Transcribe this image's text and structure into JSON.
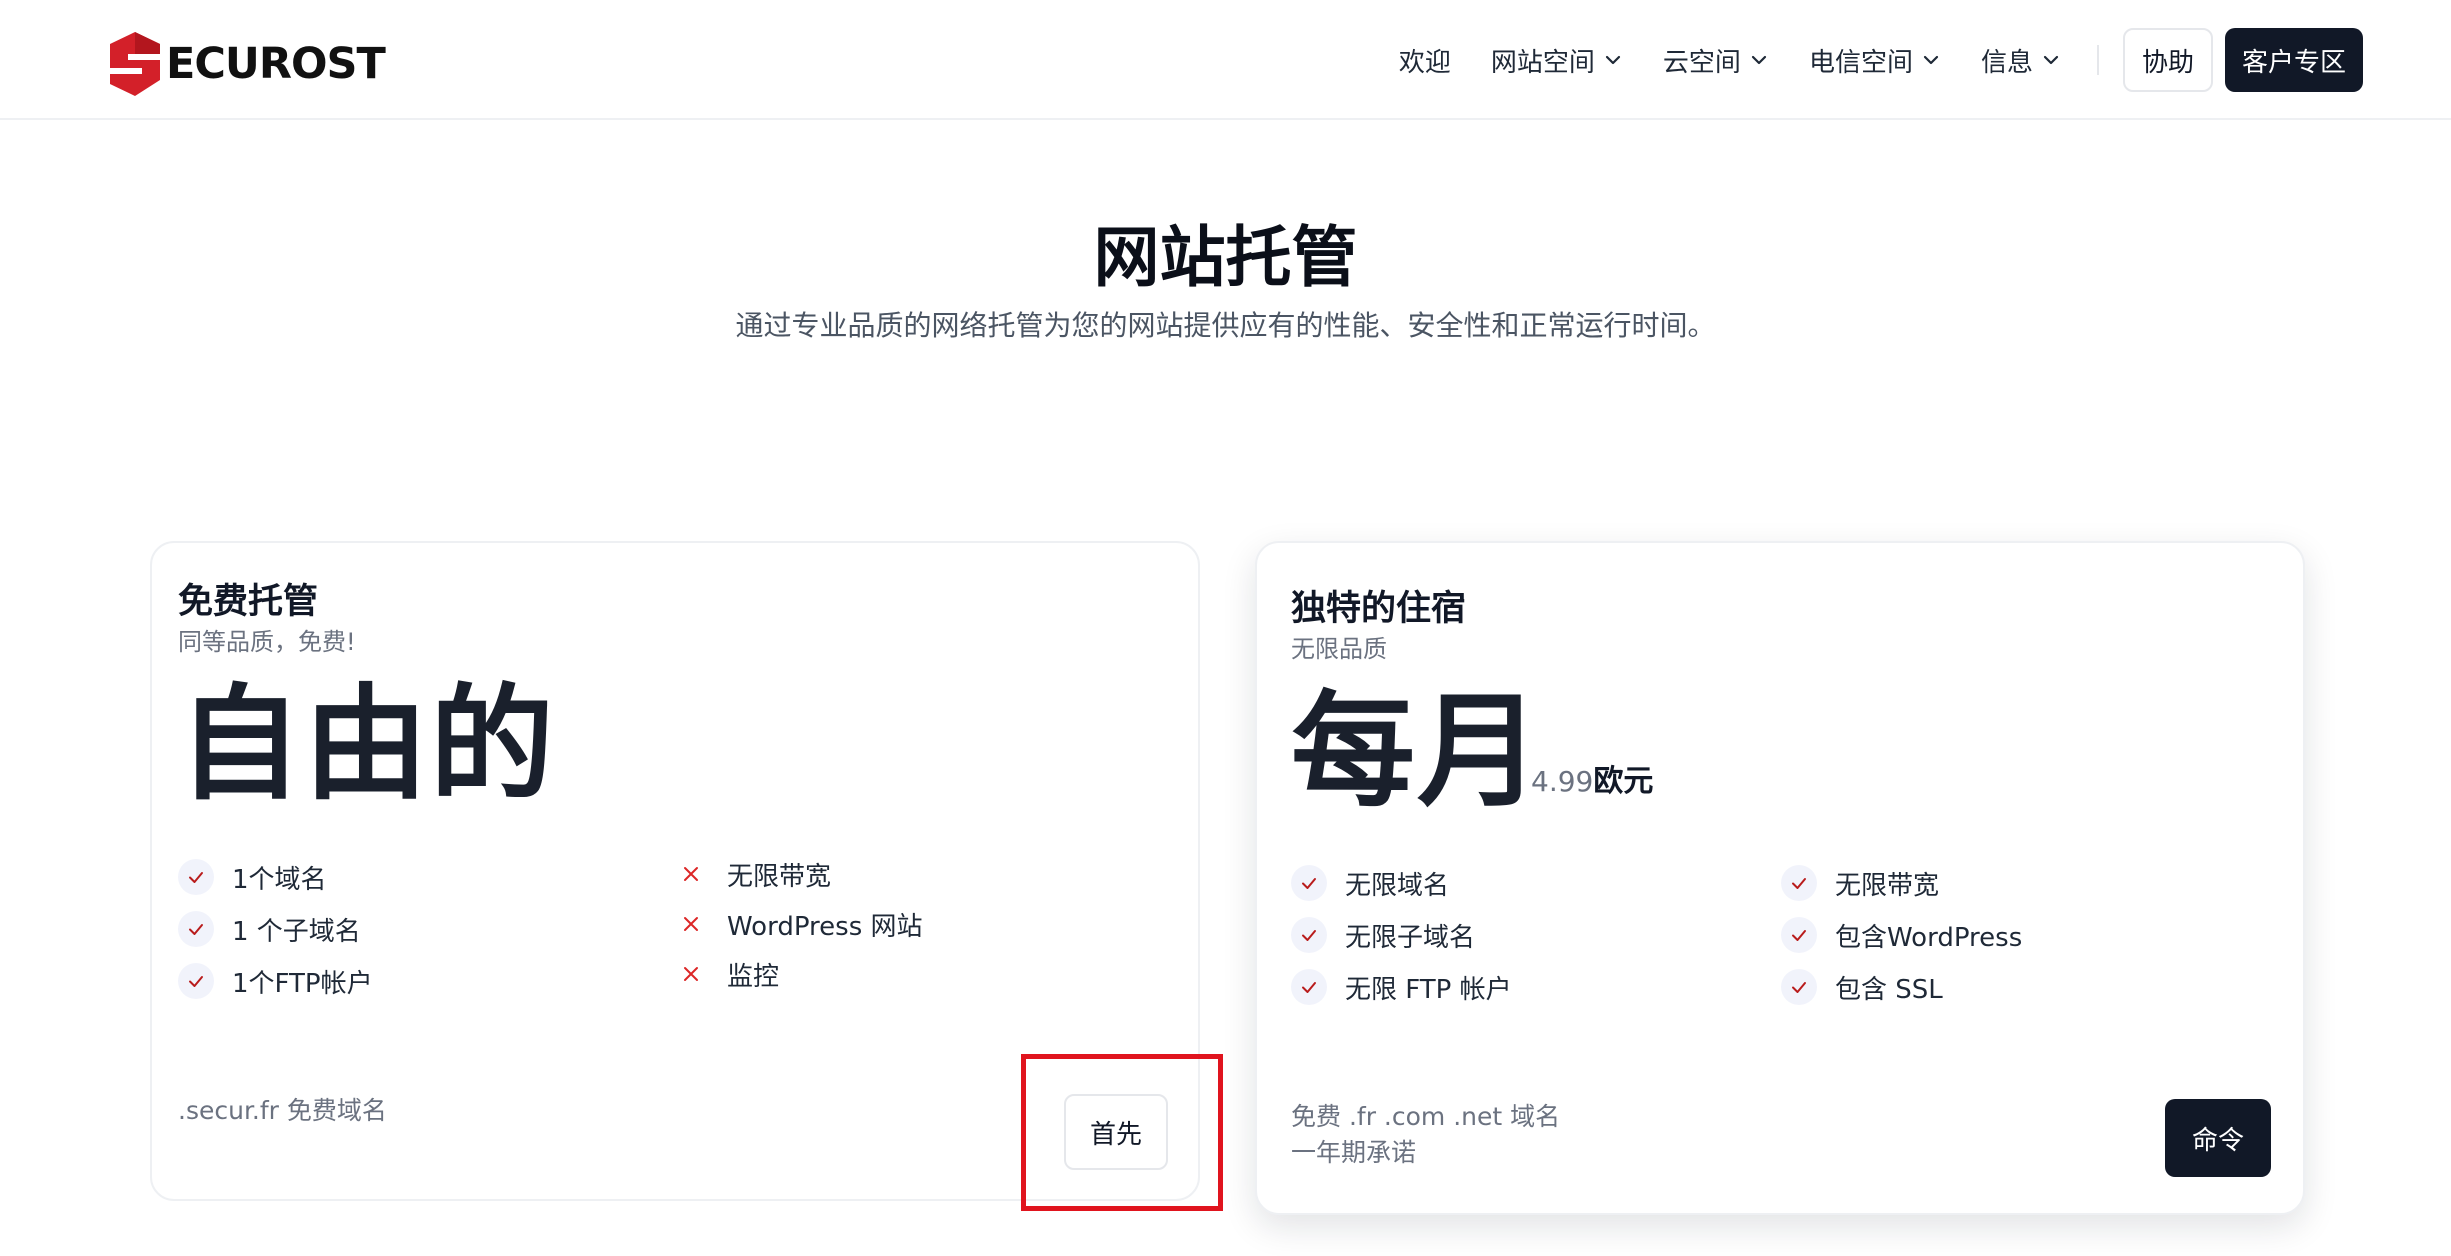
{
  "brand": {
    "logo_text": "ECUROST",
    "logo_color": "#d32029"
  },
  "nav": {
    "items": [
      {
        "label": "欢迎",
        "dropdown": false
      },
      {
        "label": "网站空间",
        "dropdown": true
      },
      {
        "label": "云空间",
        "dropdown": true
      },
      {
        "label": "电信空间",
        "dropdown": true
      },
      {
        "label": "信息",
        "dropdown": true
      }
    ],
    "help_label": "协助",
    "client_label": "客户专区"
  },
  "hero": {
    "title": "网站托管",
    "subtitle": "通过专业品质的网络托管为您的网站提供应有的性能、安全性和正常运行时间。"
  },
  "plans": [
    {
      "title": "免费托管",
      "subtitle": "同等品质，免费!",
      "price_big": "自由的",
      "features_left": [
        {
          "label": "1个域名",
          "included": true
        },
        {
          "label": "1 个子域名",
          "included": true
        },
        {
          "label": "1个FTP帐户",
          "included": true
        }
      ],
      "features_right": [
        {
          "label": "无限带宽",
          "included": false
        },
        {
          "label": "WordPress 网站",
          "included": false
        },
        {
          "label": "监控",
          "included": false
        }
      ],
      "footnote": ".secur.fr 免费域名",
      "button_label": "首先"
    },
    {
      "title": "独特的住宿",
      "subtitle": "无限品质",
      "price_big": "每月",
      "price_amount": "4.99",
      "price_unit": "欧元",
      "features_left": [
        {
          "label": "无限域名",
          "included": true
        },
        {
          "label": "无限子域名",
          "included": true
        },
        {
          "label": "无限 FTP 帐户",
          "included": true
        }
      ],
      "features_right": [
        {
          "label": "无限带宽",
          "included": true
        },
        {
          "label": "包含WordPress",
          "included": true
        },
        {
          "label": "包含 SSL",
          "included": true
        }
      ],
      "footnote_line1": "免费 .fr .com .net 域名",
      "footnote_line2": "一年期承诺",
      "button_label": "命令"
    }
  ],
  "colors": {
    "accent_dark": "#111827",
    "check_color": "#b91c1c",
    "cross_color": "#dc2626",
    "highlight": "#e0141e"
  }
}
